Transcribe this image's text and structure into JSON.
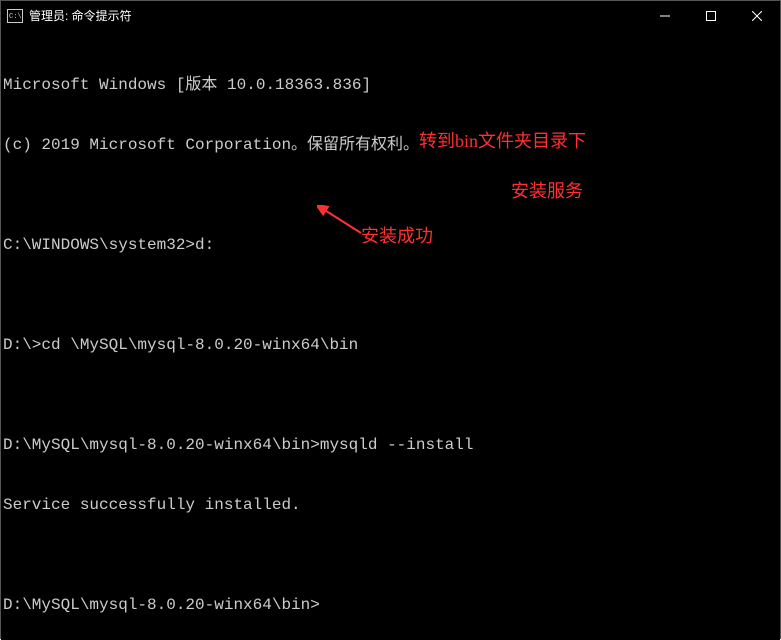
{
  "window": {
    "title": "管理员: 命令提示符"
  },
  "terminal": {
    "line1": "Microsoft Windows [版本 10.0.18363.836]",
    "line2": "(c) 2019 Microsoft Corporation。保留所有权利。",
    "line3": "",
    "line4": "C:\\WINDOWS\\system32>d:",
    "line5": "",
    "line6": "D:\\>cd \\MySQL\\mysql-8.0.20-winx64\\bin",
    "line7": "",
    "line8": "D:\\MySQL\\mysql-8.0.20-winx64\\bin>mysqld --install",
    "line9": "Service successfully installed.",
    "line10": "",
    "line11": "D:\\MySQL\\mysql-8.0.20-winx64\\bin>"
  },
  "annotations": {
    "note1": "转到bin文件夹目录下",
    "note2": "安装服务",
    "note3": "安装成功"
  }
}
